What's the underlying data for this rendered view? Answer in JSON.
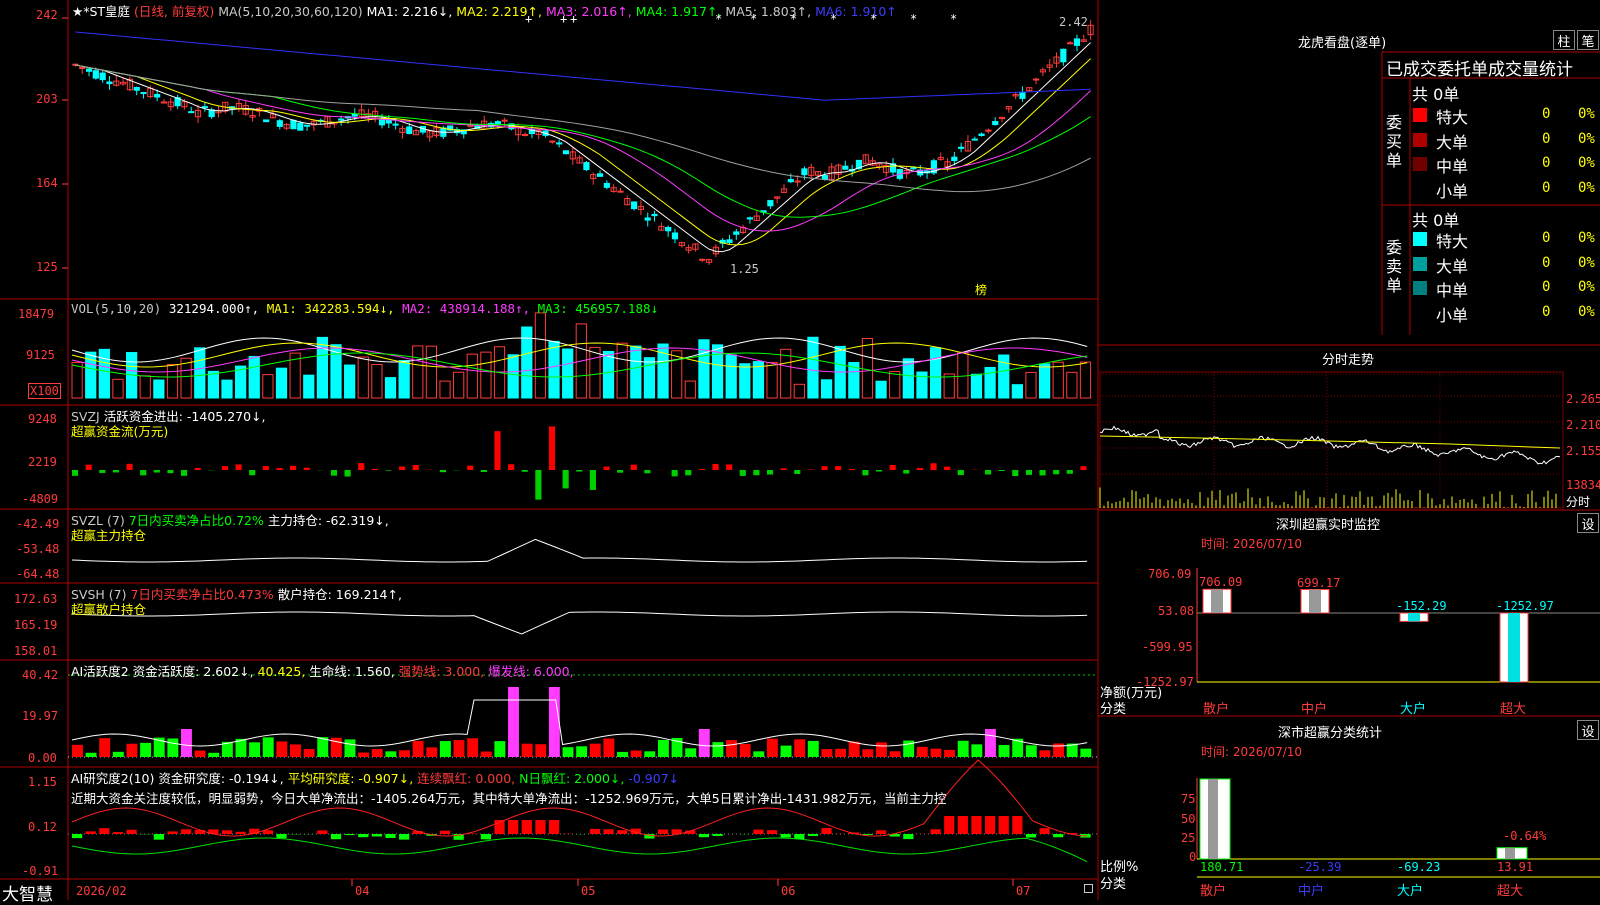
{
  "kline": {
    "stock_name": "★*ST皇庭",
    "mode": "(日线, 前复权)",
    "ma_params": "MA(5,10,20,30,60,120)",
    "ma1": "MA1: 2.216↓,",
    "ma2": "MA2: 2.219↑,",
    "ma3": "MA3: 2.016↑,",
    "ma4": "MA4: 1.917↑,",
    "ma5": "MA5: 1.803↑,",
    "ma6": "MA6: 1.910↑",
    "y_ticks": [
      "242",
      "203",
      "164",
      "125"
    ],
    "high_label": "2.42",
    "low_label": "1.25",
    "bang_label": "榜",
    "markers": [
      "+",
      "+",
      "+",
      "*",
      "*",
      "*",
      "*",
      "*",
      "*",
      "*"
    ]
  },
  "vol": {
    "head": "VOL(5,10,20)",
    "value": "321294.000↑,",
    "ma1": "MA1: 342283.594↓,",
    "ma2": "MA2: 438914.188↑,",
    "ma3": "MA3: 456957.188↓",
    "y_ticks": [
      "18479",
      "9125"
    ],
    "unit": "X100"
  },
  "svzj": {
    "head": "SVZJ",
    "line1": "活跃资金进出: -1405.270↓,",
    "line2": "超赢资金流(万元)",
    "y_ticks": [
      "9248",
      "2219",
      "-4809"
    ]
  },
  "svzl": {
    "head": "SVZL (7)",
    "ratio": "7日内买卖净占比0.72%",
    "hold": "主力持仓: -62.319↓,",
    "line2": "超赢主力持仓",
    "y_ticks": [
      "-42.49",
      "-53.48",
      "-64.48"
    ]
  },
  "svsh": {
    "head": "SVSH (7)",
    "ratio": "7日内买卖净占比0.473%",
    "hold": "散户持仓: 169.214↑,",
    "line2": "超赢散户持仓",
    "y_ticks": [
      "172.63",
      "165.19",
      "158.01"
    ]
  },
  "ai_active": {
    "head": "AI活跃度2 资金活跃度: 2.602↓,",
    "v2": "40.425,",
    "life": "生命线: 1.560,",
    "strong": "强势线: 3.000,",
    "burst": "爆发线: 6.000,",
    "y_ticks": [
      "40.42",
      "19.97",
      "0.00"
    ]
  },
  "ai_research": {
    "head": "AI研究度2(10) 资金研究度: -0.194↓,",
    "avg": "平均研究度: -0.907↓,",
    "lianxu": "连续飘红: 0.000,",
    "nday": "N日飘红: 2.000↓,",
    "last": "-0.907↓",
    "commentary": "近期大资金关注度较低，明显弱势，今日大单净流出：-1405.264万元，其中特大单净流出：-1252.969万元，大单5日累计净出-1431.982万元，当前主力控",
    "y_ticks": [
      "1.15",
      "0.12",
      "-0.91"
    ]
  },
  "xaxis": {
    "brand": "大智慧",
    "labels": [
      "2026/02",
      "04",
      "05",
      "06",
      "07"
    ]
  },
  "right": {
    "lhb_title": "龙虎看盘(逐单)",
    "btn_zhu": "柱",
    "btn_bi": "笔",
    "order_title": "已成交委托单成交量统计",
    "buy_label": "委买单",
    "sell_label": "委卖单",
    "buy_total": "共 0单",
    "sell_total": "共 0单",
    "buy_rows": [
      {
        "name": "特大",
        "n": "0",
        "pct": "0%",
        "color": "#ff0000"
      },
      {
        "name": "大单",
        "n": "0",
        "pct": "0%",
        "color": "#b00000"
      },
      {
        "name": "中单",
        "n": "0",
        "pct": "0%",
        "color": "#700000"
      },
      {
        "name": "小单",
        "n": "0",
        "pct": "0%",
        "color": ""
      }
    ],
    "sell_rows": [
      {
        "name": "特大",
        "n": "0",
        "pct": "0%",
        "color": "#00ffff"
      },
      {
        "name": "大单",
        "n": "0",
        "pct": "0%",
        "color": "#00a0a0"
      },
      {
        "name": "中单",
        "n": "0",
        "pct": "0%",
        "color": "#008080"
      },
      {
        "name": "小单",
        "n": "0",
        "pct": "0%",
        "color": ""
      }
    ],
    "fenshi_title": "分时走势",
    "fenshi_ticks": [
      "2.265",
      "2.210",
      "2.155"
    ],
    "fenshi_vol": "13834",
    "fenshi_label": "分时",
    "sz_title": "深圳超赢实时监控",
    "set_label": "设",
    "time_label": "时间: 2026/07/10",
    "net_yticks": [
      "706.09",
      "53.08",
      "-599.95",
      "-1252.97"
    ],
    "net_axis": "净额(万元)",
    "cat_axis": "分类",
    "categories": [
      "散户",
      "中户",
      "大户",
      "超大"
    ],
    "net_values": [
      "706.09",
      "699.17",
      "-152.29",
      "-1252.97"
    ],
    "sc_title": "深市超赢分类统计",
    "ratio_yticks": [
      "75",
      "50",
      "25",
      "0"
    ],
    "ratio_axis": "比例%",
    "ratio_values": [
      "180.71",
      "-25.39",
      "-69.23",
      "13.91"
    ],
    "ratio_note": "-0.64%"
  }
}
